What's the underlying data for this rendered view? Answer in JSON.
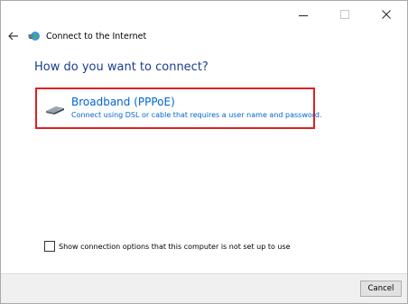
{
  "window": {
    "title": "Connect to the Internet"
  },
  "page": {
    "heading": "How do you want to connect?"
  },
  "option": {
    "title": "Broadband (PPPoE)",
    "description": "Connect using DSL or cable that requires a user name and password."
  },
  "checkbox": {
    "label": "Show connection options that this computer is not set up to use",
    "checked": false
  },
  "footer": {
    "cancel_label": "Cancel"
  },
  "icons": {
    "back": "back-arrow-icon",
    "app": "network-globe-icon",
    "option": "modem-icon",
    "minimize": "minimize-icon",
    "maximize": "maximize-icon",
    "close": "close-icon"
  },
  "colors": {
    "heading": "#1a3d8f",
    "link": "#0066cc",
    "highlight_border": "#e02020"
  }
}
